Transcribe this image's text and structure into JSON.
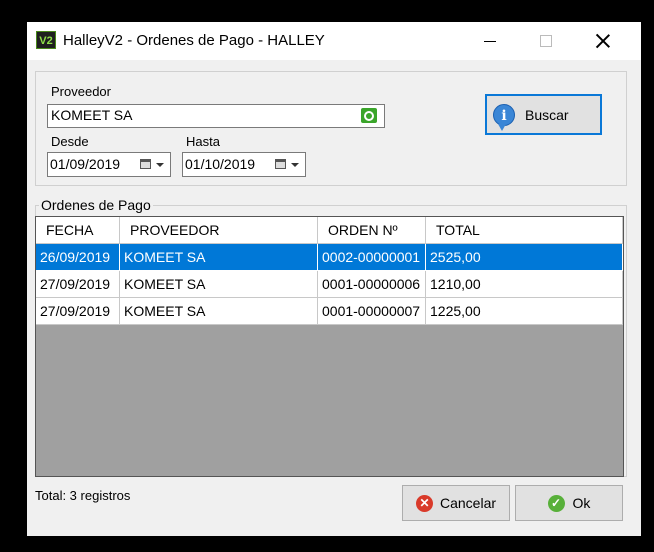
{
  "window": {
    "icon_text": "V2",
    "title": "HalleyV2 - Ordenes de Pago - HALLEY"
  },
  "filters": {
    "proveedor_label": "Proveedor",
    "proveedor_value": "KOMEET SA",
    "desde_label": "Desde",
    "desde_value": "01/09/2019",
    "hasta_label": "Hasta",
    "hasta_value": "01/10/2019",
    "buscar_label": "Buscar"
  },
  "orders": {
    "group_title": "Ordenes de Pago",
    "columns": [
      "FECHA",
      "PROVEEDOR",
      "ORDEN Nº",
      "TOTAL"
    ],
    "rows": [
      {
        "fecha": "26/09/2019",
        "proveedor": "KOMEET SA",
        "orden": "0002-00000001",
        "total": "2525,00"
      },
      {
        "fecha": "27/09/2019",
        "proveedor": "KOMEET SA",
        "orden": "0001-00000006",
        "total": "1210,00"
      },
      {
        "fecha": "27/09/2019",
        "proveedor": "KOMEET SA",
        "orden": "0001-00000007",
        "total": "1225,00"
      }
    ]
  },
  "footer": {
    "status": "Total: 3 registros",
    "cancel_label": "Cancelar",
    "ok_label": "Ok"
  },
  "colors": {
    "selection": "#0078d7",
    "focus_border": "#0a78d7",
    "grid_empty": "#a0a0a0"
  }
}
